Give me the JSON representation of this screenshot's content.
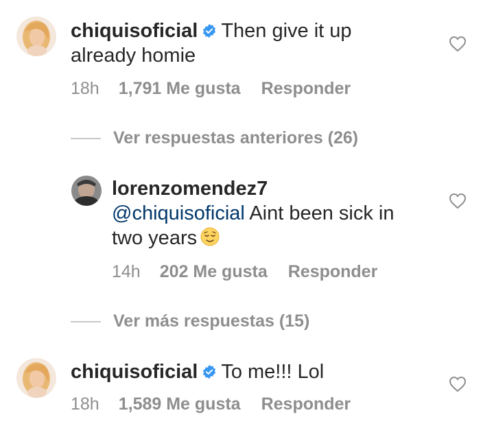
{
  "comments": [
    {
      "username": "chiquisoficial",
      "verified": true,
      "text_line1": "Then give it up",
      "text_line2": "already homie",
      "time": "18h",
      "likes": "1,791 Me gusta",
      "reply": "Responder"
    },
    {
      "username": "lorenzomendez7",
      "verified": false,
      "mention": "@chiquisoficial",
      "text_line1": " Aint been sick in",
      "text_line2": "two years",
      "time": "14h",
      "likes": "202 Me gusta",
      "reply": "Responder"
    },
    {
      "username": "chiquisoficial",
      "verified": true,
      "text_line1": "To me!!! Lol",
      "time": "18h",
      "likes": "1,589 Me gusta",
      "reply": "Responder"
    }
  ],
  "view_previous": "Ver respuestas anteriores (26)",
  "view_more": "Ver más respuestas (15)",
  "icons": {
    "verified": "verified-badge-icon",
    "like": "heart-outline-icon",
    "emoji": "relieved-face-emoji"
  },
  "colors": {
    "verified": "#3897f0",
    "mention": "#00376b",
    "meta": "#8e8e8e"
  }
}
